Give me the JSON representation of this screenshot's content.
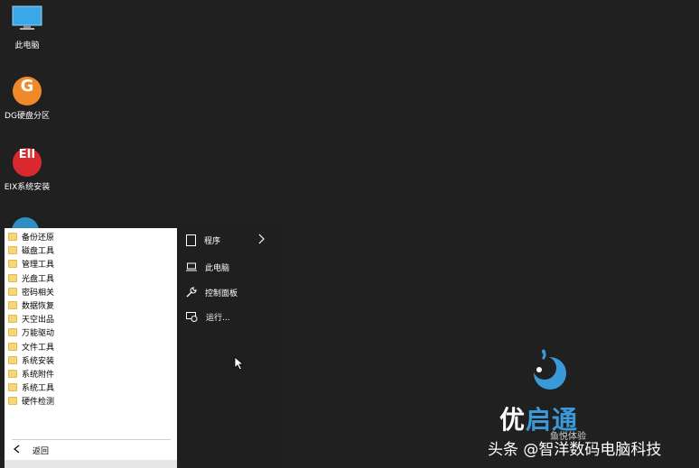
{
  "desktop": {
    "icons": [
      {
        "label": "此电脑",
        "icon": "monitor-icon"
      },
      {
        "label": "DG硬盘分区",
        "icon": "dg-logo-icon",
        "glyph": "G",
        "color": "#f0892a"
      },
      {
        "label": "EIX系统安装",
        "icon": "eix-logo-icon",
        "glyph": "EII",
        "color": "#d9292f"
      }
    ]
  },
  "start_menu": {
    "items": [
      {
        "label": "备份还原"
      },
      {
        "label": "磁盘工具"
      },
      {
        "label": "管理工具"
      },
      {
        "label": "光盘工具"
      },
      {
        "label": "密码相关"
      },
      {
        "label": "数据恢复"
      },
      {
        "label": "天空出品"
      },
      {
        "label": "万能驱动"
      },
      {
        "label": "文件工具"
      },
      {
        "label": "系统安装"
      },
      {
        "label": "系统附件"
      },
      {
        "label": "系统工具"
      },
      {
        "label": "硬件检测"
      }
    ],
    "back_label": "返回",
    "right": {
      "programs": "程序",
      "this_pc": "此电脑",
      "control_panel": "控制面板",
      "run": "运行..."
    }
  },
  "logo": {
    "text_white": "优",
    "text_blue": "启通",
    "subtitle": "鱼悦体验"
  },
  "watermark": "头条 @智洋数码电脑科技"
}
